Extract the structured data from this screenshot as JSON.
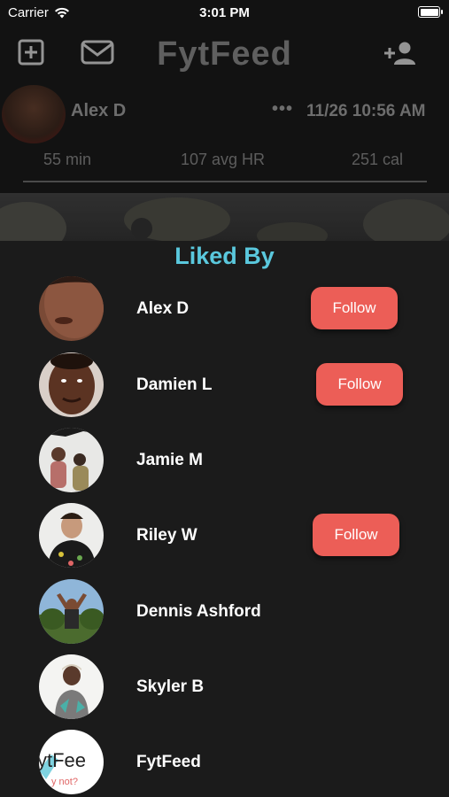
{
  "status_bar": {
    "carrier": "Carrier",
    "time": "3:01 PM"
  },
  "nav": {
    "title": "FytFeed",
    "icons": [
      "plus-square-icon",
      "mail-icon",
      "add-person-icon"
    ]
  },
  "post": {
    "author": "Alex D",
    "more": "•••",
    "timestamp": "11/26 10:56 AM",
    "stats": {
      "duration": "55 min",
      "heart_rate": "107 avg HR",
      "calories": "251 cal"
    }
  },
  "liked_by": {
    "title": "Liked By",
    "follow_label": "Follow",
    "users": [
      {
        "name": "Alex D",
        "show_follow": true
      },
      {
        "name": "Damien L",
        "show_follow": true
      },
      {
        "name": "Jamie M",
        "show_follow": false
      },
      {
        "name": "Riley W",
        "show_follow": true
      },
      {
        "name": "Dennis Ashford",
        "show_follow": false
      },
      {
        "name": "Skyler B",
        "show_follow": false
      },
      {
        "name": "FytFeed",
        "show_follow": false
      }
    ]
  },
  "colors": {
    "accent": "#5ac8dd",
    "follow": "#ec5e57",
    "background": "#1b1b1b"
  }
}
